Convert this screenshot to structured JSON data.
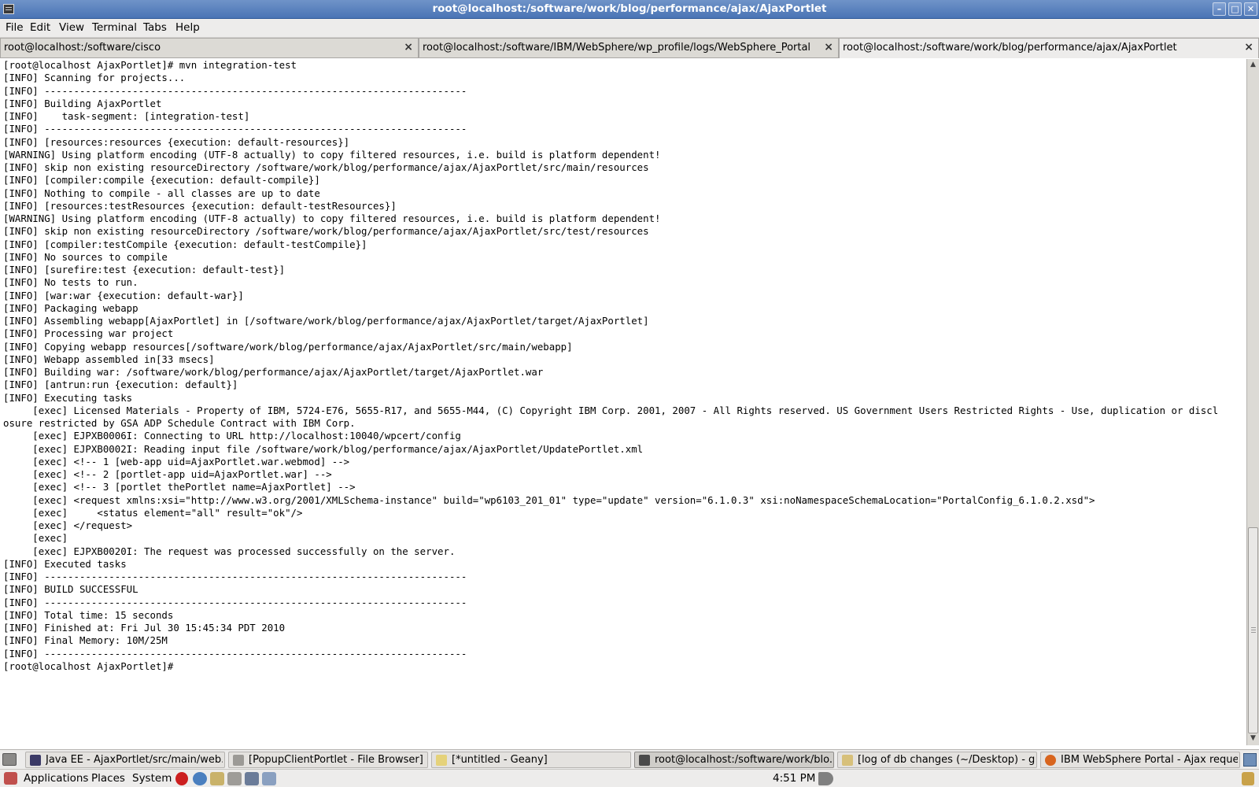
{
  "window": {
    "title": "root@localhost:/software/work/blog/performance/ajax/AjaxPortlet",
    "min_glyph": "–",
    "max_glyph": "□",
    "close_glyph": "✕"
  },
  "menu": [
    "File",
    "Edit",
    "View",
    "Terminal",
    "Tabs",
    "Help"
  ],
  "tabs": [
    {
      "label": "root@localhost:/software/cisco",
      "close": "×"
    },
    {
      "label": "root@localhost:/software/IBM/WebSphere/wp_profile/logs/WebSphere_Portal",
      "close": "×"
    },
    {
      "label": "root@localhost:/software/work/blog/performance/ajax/AjaxPortlet",
      "close": "×"
    }
  ],
  "terminal_lines": [
    "[root@localhost AjaxPortlet]# mvn integration-test",
    "[INFO] Scanning for projects...",
    "[INFO] ------------------------------------------------------------------------",
    "[INFO] Building AjaxPortlet",
    "[INFO]    task-segment: [integration-test]",
    "[INFO] ------------------------------------------------------------------------",
    "[INFO] [resources:resources {execution: default-resources}]",
    "[WARNING] Using platform encoding (UTF-8 actually) to copy filtered resources, i.e. build is platform dependent!",
    "[INFO] skip non existing resourceDirectory /software/work/blog/performance/ajax/AjaxPortlet/src/main/resources",
    "[INFO] [compiler:compile {execution: default-compile}]",
    "[INFO] Nothing to compile - all classes are up to date",
    "[INFO] [resources:testResources {execution: default-testResources}]",
    "[WARNING] Using platform encoding (UTF-8 actually) to copy filtered resources, i.e. build is platform dependent!",
    "[INFO] skip non existing resourceDirectory /software/work/blog/performance/ajax/AjaxPortlet/src/test/resources",
    "[INFO] [compiler:testCompile {execution: default-testCompile}]",
    "[INFO] No sources to compile",
    "[INFO] [surefire:test {execution: default-test}]",
    "[INFO] No tests to run.",
    "[INFO] [war:war {execution: default-war}]",
    "[INFO] Packaging webapp",
    "[INFO] Assembling webapp[AjaxPortlet] in [/software/work/blog/performance/ajax/AjaxPortlet/target/AjaxPortlet]",
    "[INFO] Processing war project",
    "[INFO] Copying webapp resources[/software/work/blog/performance/ajax/AjaxPortlet/src/main/webapp]",
    "[INFO] Webapp assembled in[33 msecs]",
    "[INFO] Building war: /software/work/blog/performance/ajax/AjaxPortlet/target/AjaxPortlet.war",
    "[INFO] [antrun:run {execution: default}]",
    "[INFO] Executing tasks",
    "     [exec] Licensed Materials - Property of IBM, 5724-E76, 5655-R17, and 5655-M44, (C) Copyright IBM Corp. 2001, 2007 - All Rights reserved. US Government Users Restricted Rights - Use, duplication or discl",
    "osure restricted by GSA ADP Schedule Contract with IBM Corp.",
    "     [exec] EJPXB0006I: Connecting to URL http://localhost:10040/wpcert/config",
    "     [exec] EJPXB0002I: Reading input file /software/work/blog/performance/ajax/AjaxPortlet/UpdatePortlet.xml",
    "     [exec] <!-- 1 [web-app uid=AjaxPortlet.war.webmod] -->",
    "     [exec] <!-- 2 [portlet-app uid=AjaxPortlet.war] -->",
    "     [exec] <!-- 3 [portlet thePortlet name=AjaxPortlet] -->",
    "     [exec] <request xmlns:xsi=\"http://www.w3.org/2001/XMLSchema-instance\" build=\"wp6103_201_01\" type=\"update\" version=\"6.1.0.3\" xsi:noNamespaceSchemaLocation=\"PortalConfig_6.1.0.2.xsd\">",
    "     [exec]     <status element=\"all\" result=\"ok\"/>",
    "     [exec] </request>",
    "     [exec]",
    "     [exec] EJPXB0020I: The request was processed successfully on the server.",
    "[INFO] Executed tasks",
    "[INFO] ------------------------------------------------------------------------",
    "[INFO] BUILD SUCCESSFUL",
    "[INFO] ------------------------------------------------------------------------",
    "[INFO] Total time: 15 seconds",
    "[INFO] Finished at: Fri Jul 30 15:45:34 PDT 2010",
    "[INFO] Final Memory: 10M/25M",
    "[INFO] ------------------------------------------------------------------------",
    "[root@localhost AjaxPortlet]# "
  ],
  "taskbar": [
    {
      "label": "Java EE - AjaxPortlet/src/main/web...",
      "icon": "eclipse-icon",
      "color": "#3b3a66"
    },
    {
      "label": "[PopupClientPortlet - File Browser]",
      "icon": "file-browser-icon",
      "color": "#9c9a96"
    },
    {
      "label": "[*untitled - Geany]",
      "icon": "geany-icon",
      "color": "#e5d27a"
    },
    {
      "label": "root@localhost:/software/work/blo...",
      "icon": "terminal-icon",
      "color": "#4a4a4a"
    },
    {
      "label": "[log of db changes (~/Desktop) - g...",
      "icon": "gedit-icon",
      "color": "#d7c07a"
    },
    {
      "label": "IBM WebSphere Portal - Ajax reque...",
      "icon": "firefox-icon",
      "color": "#d8651e"
    }
  ],
  "panel": {
    "menus": [
      "Applications",
      "Places",
      "System"
    ],
    "clock": "4:51 PM"
  },
  "colors": {
    "titlebar": "#5a82bf",
    "terminal_bg": "#ffffff",
    "terminal_fg": "#000000"
  }
}
